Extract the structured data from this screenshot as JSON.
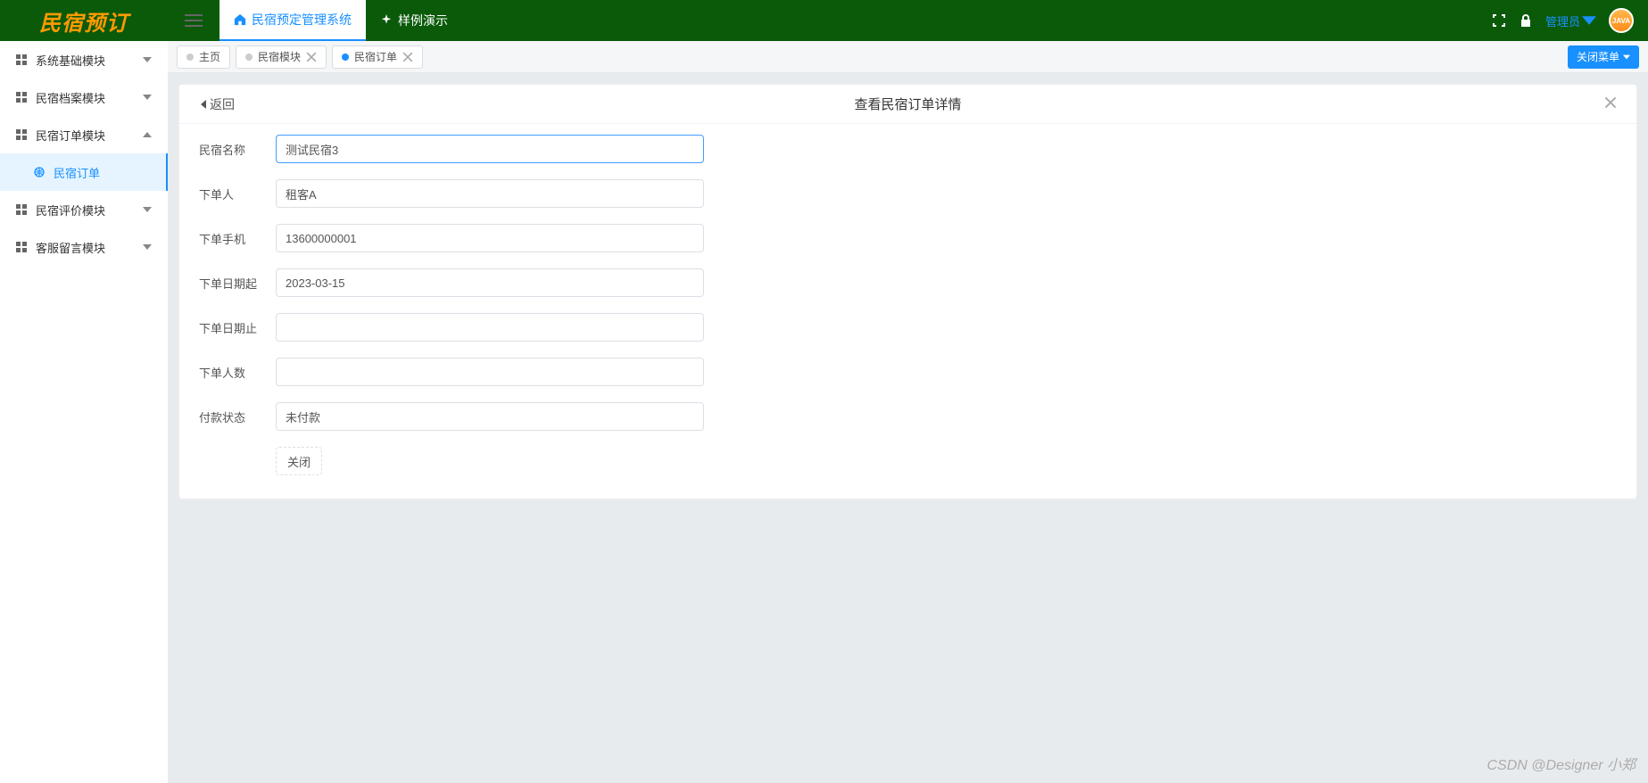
{
  "header": {
    "logo": "民宿预订",
    "nav": [
      {
        "label": "民宿预定管理系统",
        "icon": "home"
      },
      {
        "label": "样例演示",
        "icon": "sparkle"
      }
    ],
    "admin_label": "管理员",
    "avatar_text": "JAVA"
  },
  "sidebar": {
    "items": [
      {
        "label": "系统基础模块",
        "expanded": false
      },
      {
        "label": "民宿档案模块",
        "expanded": false
      },
      {
        "label": "民宿订单模块",
        "expanded": true,
        "children": [
          {
            "label": "民宿订单"
          }
        ]
      },
      {
        "label": "民宿评价模块",
        "expanded": false
      },
      {
        "label": "客服留言模块",
        "expanded": false
      }
    ]
  },
  "tabs": {
    "items": [
      {
        "label": "主页",
        "closable": false,
        "active": false
      },
      {
        "label": "民宿模块",
        "closable": true,
        "active": false
      },
      {
        "label": "民宿订单",
        "closable": true,
        "active": true
      }
    ],
    "close_menu_label": "关闭菜单"
  },
  "panel": {
    "back_label": "返回",
    "title": "查看民宿订单详情",
    "form": {
      "fields": [
        {
          "label": "民宿名称",
          "value": "测试民宿3",
          "focused": true
        },
        {
          "label": "下单人",
          "value": "租客A"
        },
        {
          "label": "下单手机",
          "value": "13600000001"
        },
        {
          "label": "下单日期起",
          "value": "2023-03-15"
        },
        {
          "label": "下单日期止",
          "value": ""
        },
        {
          "label": "下单人数",
          "value": ""
        },
        {
          "label": "付款状态",
          "value": "未付款"
        }
      ],
      "close_btn": "关闭"
    }
  },
  "watermark": "CSDN @Designer 小郑"
}
